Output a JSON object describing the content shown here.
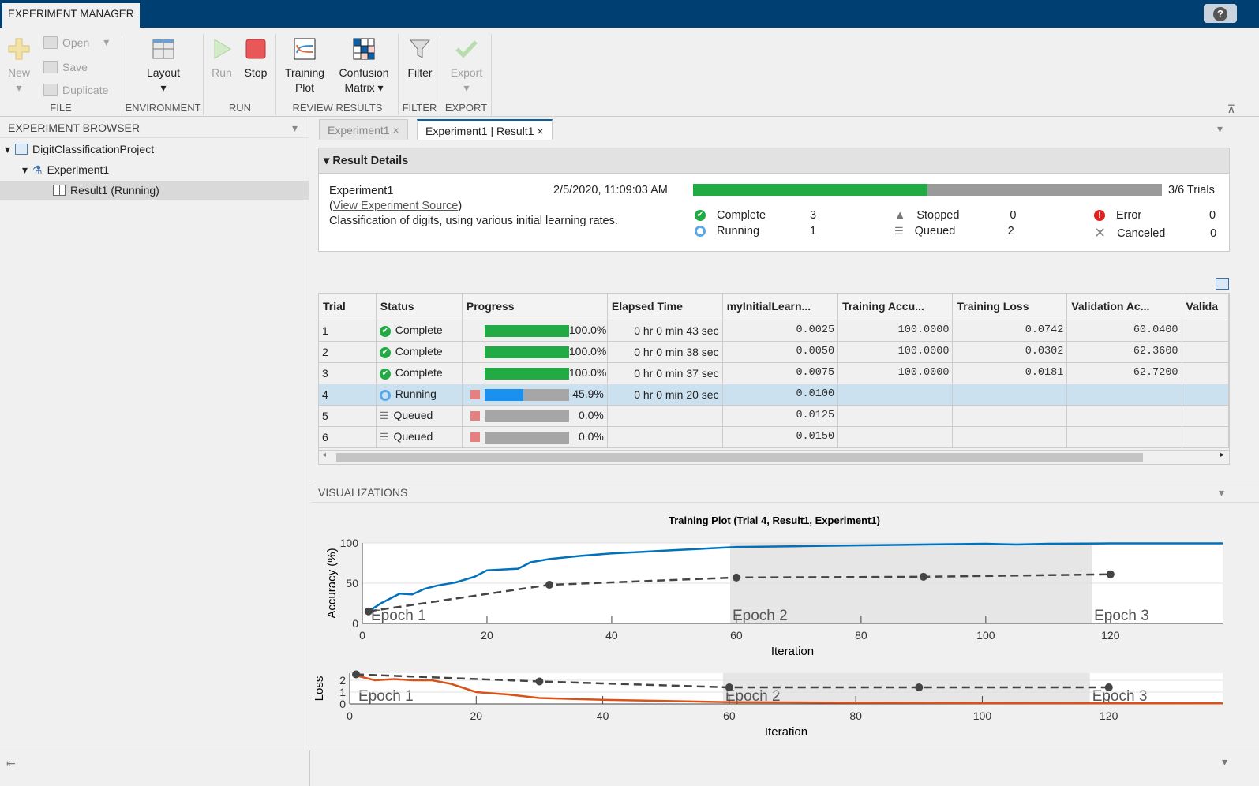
{
  "app": {
    "tab": "EXPERIMENT MANAGER",
    "help": "?"
  },
  "toolstrip": {
    "file": {
      "label": "FILE",
      "new": "New",
      "open": "Open",
      "save": "Save",
      "duplicate": "Duplicate"
    },
    "environment": {
      "label": "ENVIRONMENT",
      "layout": "Layout"
    },
    "run": {
      "label": "RUN",
      "run": "Run",
      "stop": "Stop"
    },
    "review": {
      "label": "REVIEW RESULTS",
      "training_plot": [
        "Training",
        "Plot"
      ],
      "confusion_matrix": [
        "Confusion",
        "Matrix"
      ]
    },
    "filter": {
      "label": "FILTER",
      "filter": "Filter"
    },
    "export": {
      "label": "EXPORT",
      "export": "Export"
    }
  },
  "browser": {
    "title": "EXPERIMENT BROWSER",
    "project": "DigitClassificationProject",
    "experiment": "Experiment1",
    "result": "Result1 (Running)"
  },
  "tabs": [
    {
      "label": "Experiment1"
    },
    {
      "label": "Experiment1 | Result1"
    }
  ],
  "details": {
    "title": "Result Details",
    "experiment": "Experiment1",
    "source_open": "(",
    "source_link": "View Experiment Source",
    "source_close": ")",
    "description": "Classification of digits, using various initial learning rates.",
    "timestamp": "2/5/2020, 11:09:03 AM",
    "progress_fraction": 0.5,
    "trials": "3/6 Trials",
    "counts": [
      {
        "label": "Complete",
        "value": "3",
        "icon": "check-circle"
      },
      {
        "label": "Running",
        "value": "1",
        "icon": "ring"
      },
      {
        "label": "Stopped",
        "value": "0",
        "icon": "warning-triangle"
      },
      {
        "label": "Queued",
        "value": "2",
        "icon": "queue"
      },
      {
        "label": "Error",
        "value": "0",
        "icon": "error-circle"
      },
      {
        "label": "Canceled",
        "value": "0",
        "icon": "x"
      }
    ]
  },
  "table": {
    "columns": [
      "Trial",
      "Status",
      "Progress",
      "Elapsed Time",
      "myInitialLearn...",
      "Training Accu...",
      "Training Loss",
      "Validation Ac...",
      "Valida"
    ],
    "rows": [
      {
        "trial": "1",
        "status": "Complete",
        "progress": 100,
        "progress_label": "100.0%",
        "elapsed": "0 hr 0 min 43 sec",
        "lr": "0.0025",
        "tacc": "100.0000",
        "tloss": "0.0742",
        "vacc": "60.0400"
      },
      {
        "trial": "2",
        "status": "Complete",
        "progress": 100,
        "progress_label": "100.0%",
        "elapsed": "0 hr 0 min 38 sec",
        "lr": "0.0050",
        "tacc": "100.0000",
        "tloss": "0.0302",
        "vacc": "62.3600"
      },
      {
        "trial": "3",
        "status": "Complete",
        "progress": 100,
        "progress_label": "100.0%",
        "elapsed": "0 hr 0 min 37 sec",
        "lr": "0.0075",
        "tacc": "100.0000",
        "tloss": "0.0181",
        "vacc": "62.7200"
      },
      {
        "trial": "4",
        "status": "Running",
        "progress": 45.9,
        "progress_label": "45.9%",
        "elapsed": "0 hr 0 min 20 sec",
        "lr": "0.0100",
        "tacc": "",
        "tloss": "",
        "vacc": ""
      },
      {
        "trial": "5",
        "status": "Queued",
        "progress": 0,
        "progress_label": "0.0%",
        "elapsed": "",
        "lr": "0.0125",
        "tacc": "",
        "tloss": "",
        "vacc": ""
      },
      {
        "trial": "6",
        "status": "Queued",
        "progress": 0,
        "progress_label": "0.0%",
        "elapsed": "",
        "lr": "0.0150",
        "tacc": "",
        "tloss": "",
        "vacc": ""
      }
    ]
  },
  "visualizations": {
    "title": "VISUALIZATIONS"
  },
  "colors": {
    "complete": "#22aa44",
    "running": "#1a90f0",
    "progress_gray": "#a6a6a6",
    "accuracy": "#0072bd",
    "loss": "#d95319",
    "validation": "#444444",
    "topbar": "#003f72"
  },
  "chart_data": {
    "title": "Training Plot (Trial 4, Result1, Experiment1)",
    "epochs": [
      {
        "label": "Epoch 1",
        "start": 0,
        "end": 59
      },
      {
        "label": "Epoch 2",
        "start": 59,
        "end": 117,
        "shaded": true
      },
      {
        "label": "Epoch 3",
        "start": 117,
        "end": 138
      }
    ],
    "xlim": [
      0,
      138
    ],
    "accuracy": {
      "type": "line",
      "xlabel": "Iteration",
      "ylabel": "Accuracy (%)",
      "ylim": [
        0,
        100
      ],
      "yticks": [
        0,
        50,
        100
      ],
      "xticks": [
        0,
        20,
        40,
        60,
        80,
        100,
        120
      ],
      "training": {
        "x": [
          1,
          3,
          6,
          8,
          10,
          12,
          15,
          18,
          20,
          25,
          27,
          30,
          35,
          40,
          45,
          50,
          55,
          60,
          70,
          80,
          90,
          100,
          105,
          110,
          120,
          138
        ],
        "y": [
          15,
          25,
          37,
          36,
          43,
          47,
          51,
          58,
          66,
          68,
          76,
          80,
          84,
          87,
          89,
          91,
          93,
          95,
          96,
          97,
          98,
          99,
          98,
          99,
          99.5,
          99.5
        ]
      },
      "validation": {
        "x": [
          1,
          30,
          60,
          90,
          120
        ],
        "y": [
          15,
          48,
          57,
          58,
          61
        ]
      }
    },
    "loss": {
      "type": "line",
      "xlabel": "Iteration",
      "ylabel": "Loss",
      "ylim": [
        0,
        2.6
      ],
      "yticks": [
        0,
        1,
        2
      ],
      "xticks": [
        0,
        20,
        40,
        60,
        80,
        100,
        120
      ],
      "training": {
        "x": [
          1,
          4,
          7,
          10,
          13,
          16,
          20,
          25,
          30,
          40,
          50,
          60,
          80,
          100,
          138
        ],
        "y": [
          2.4,
          2.0,
          2.1,
          2.0,
          2.0,
          1.7,
          1.0,
          0.8,
          0.5,
          0.35,
          0.25,
          0.15,
          0.1,
          0.07,
          0.05
        ]
      },
      "validation": {
        "x": [
          1,
          30,
          60,
          90,
          120
        ],
        "y": [
          2.5,
          1.9,
          1.4,
          1.4,
          1.4
        ]
      }
    }
  }
}
